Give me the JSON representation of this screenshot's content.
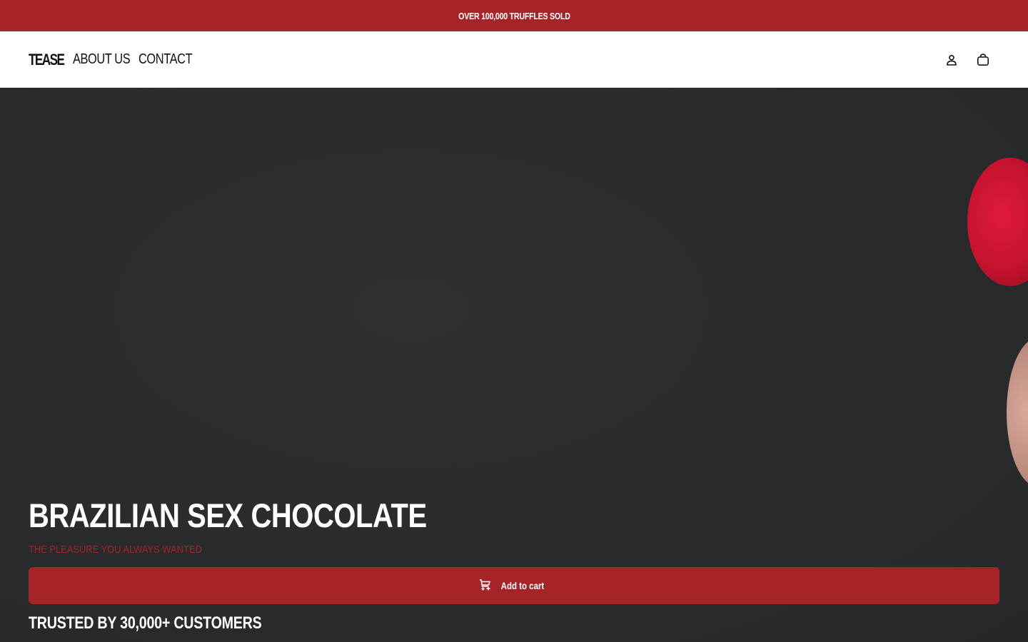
{
  "announcement": {
    "text": "OVER 100,000 TRUFFLES SOLD"
  },
  "header": {
    "logo": "TEASE",
    "nav": [
      {
        "label": "ABOUT US"
      },
      {
        "label": "CONTACT"
      }
    ],
    "icons": [
      "account-icon",
      "cart-icon"
    ]
  },
  "hero": {
    "title": "BRAZILIAN SEX CHOCOLATE",
    "subtitle": "THE PLEASURE YOU ALWAYS WANTED",
    "add_to_cart_label": "Add to cart",
    "trust_text": "TRUSTED BY 30,000+ CUSTOMERS"
  },
  "colors": {
    "brand_red": "#a52427",
    "hero_background": "#2b2c2e",
    "header_background": "#ffffff"
  }
}
